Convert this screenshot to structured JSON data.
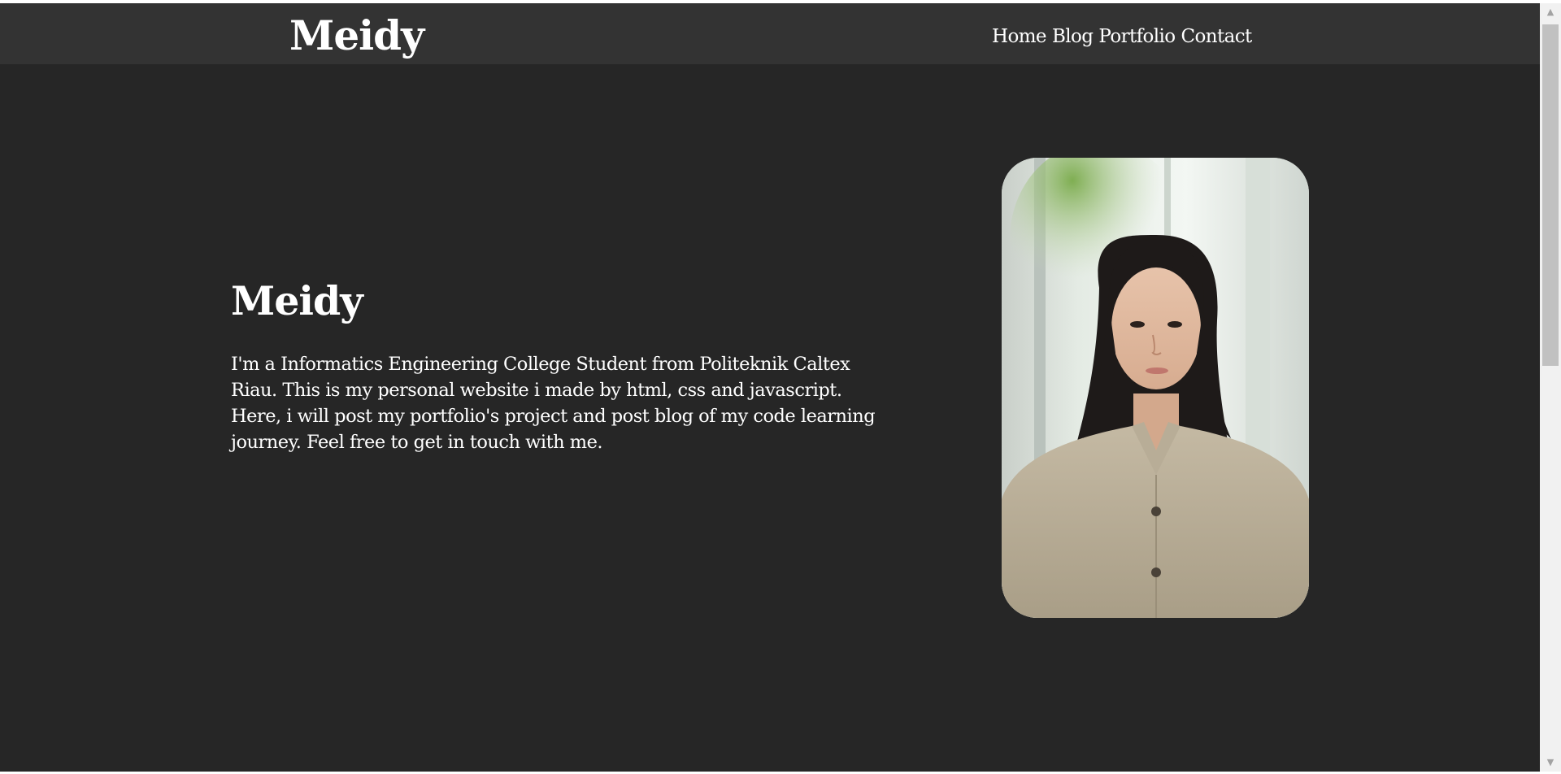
{
  "navbar": {
    "logo": "Meidy",
    "links": [
      "Home",
      "Blog",
      "Portfolio",
      "Contact"
    ]
  },
  "hero": {
    "title": "Meidy",
    "description": "I'm a Informatics Engineering College Student from Politeknik Caltex Riau. This is my personal website i made by html, css and javascript. Here, i will post my portfolio's project and post blog of my code learning journey. Feel free to get in touch with me."
  },
  "portrait": {
    "alt": "portrait-photo"
  },
  "scrollbar": {
    "up_icon": "▲",
    "down_icon": "▼"
  }
}
